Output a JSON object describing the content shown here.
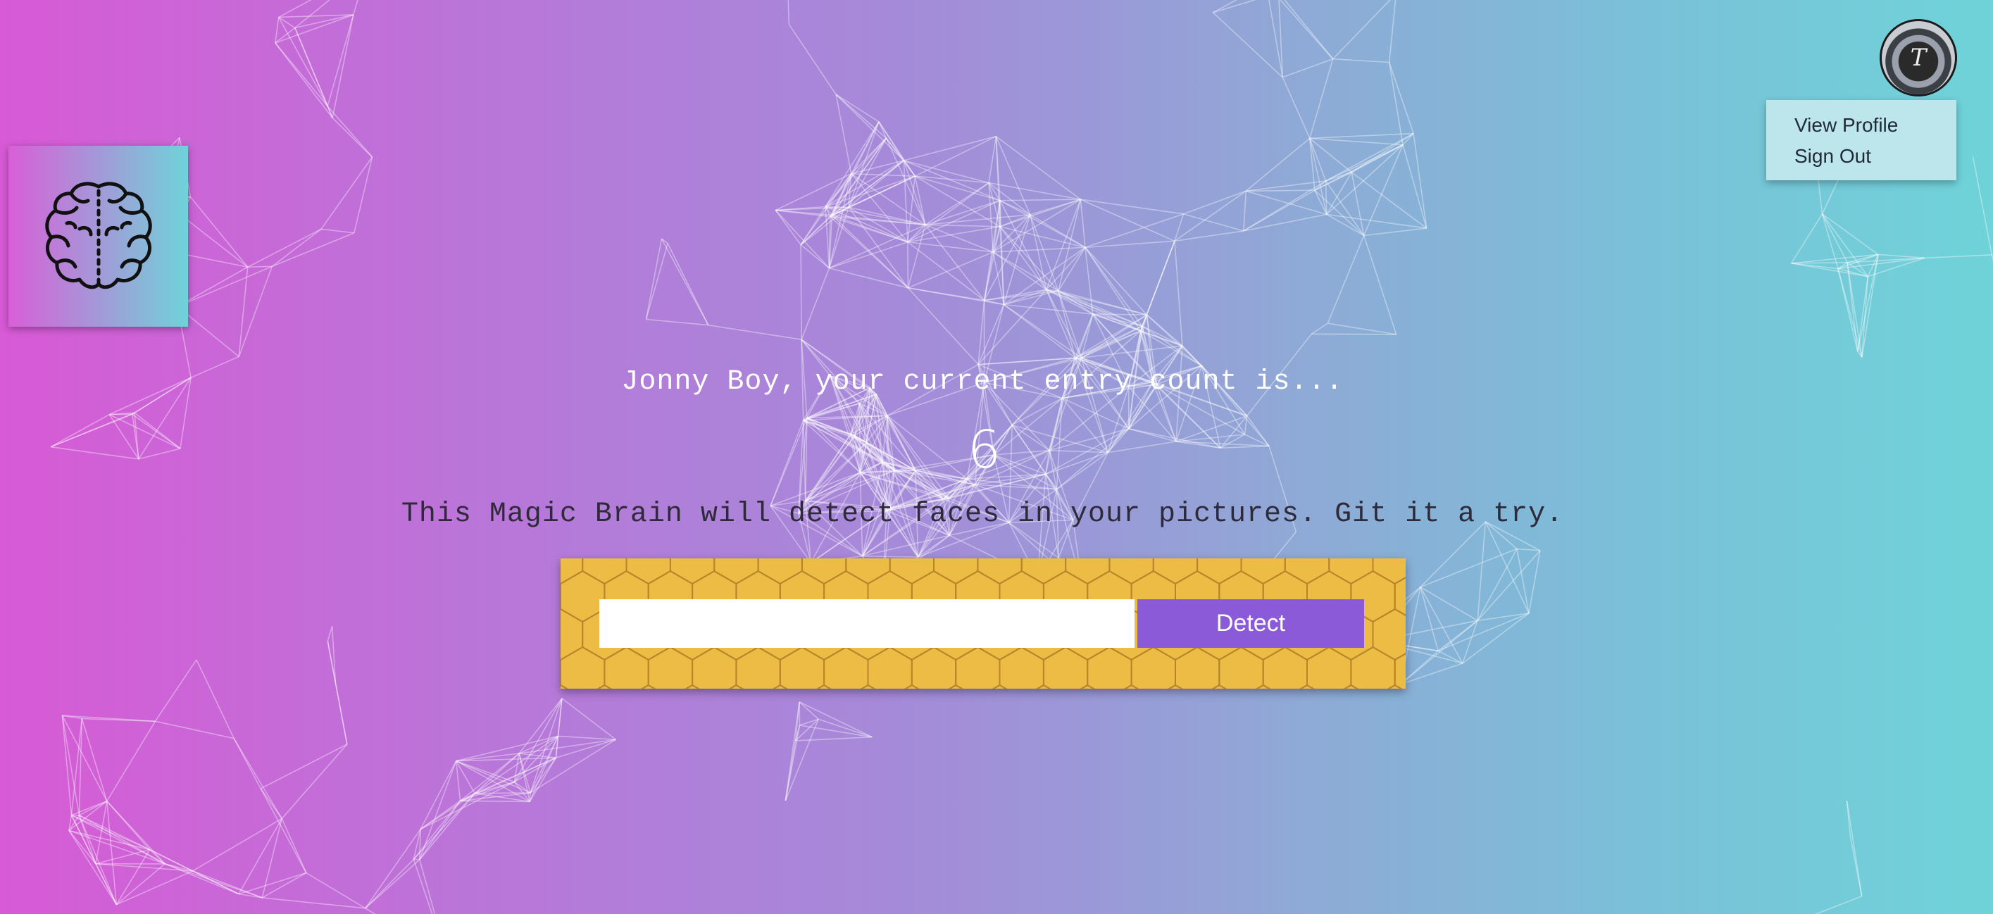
{
  "theme": {
    "background_gradient": [
      "#d75ad6",
      "#6fd3d9"
    ],
    "panel_color": "#ecbc45",
    "button_color": "#8a5ad9",
    "dropdown_color": "#bde6ec"
  },
  "logo": {
    "icon": "brain-icon"
  },
  "profile": {
    "avatar_icon": "avatar-icon",
    "avatar_letter": "T",
    "menu": {
      "view_profile": "View Profile",
      "sign_out": "Sign Out"
    }
  },
  "main": {
    "greeting": "Jonny Boy, your current entry count is...",
    "entry_count": "6",
    "description": "This Magic Brain will detect faces in your pictures. Git it a try."
  },
  "form": {
    "input_value": "",
    "input_placeholder": "",
    "detect_label": "Detect"
  }
}
